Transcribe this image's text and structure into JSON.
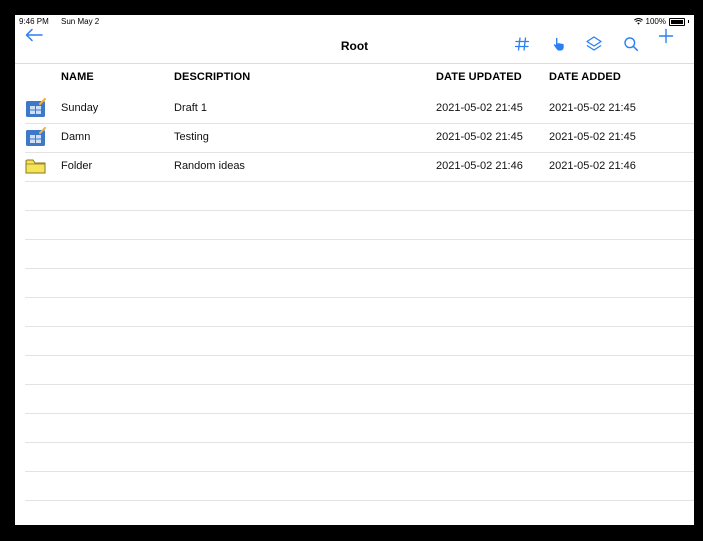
{
  "status": {
    "time": "9:46 PM",
    "date": "Sun May 2",
    "battery": "100%"
  },
  "nav": {
    "title": "Root"
  },
  "table": {
    "columns": [
      "NAME",
      "DESCRIPTION",
      "DATE UPDATED",
      "DATE ADDED"
    ],
    "rows": [
      {
        "icon": "database-icon",
        "name": "Sunday",
        "description": "Draft 1",
        "updated": "2021-05-02 21:45",
        "added": "2021-05-02 21:45"
      },
      {
        "icon": "database-icon",
        "name": "Damn",
        "description": "Testing",
        "updated": "2021-05-02 21:45",
        "added": "2021-05-02 21:45"
      },
      {
        "icon": "folder-icon",
        "name": "Folder",
        "description": "Random ideas",
        "updated": "2021-05-02 21:46",
        "added": "2021-05-02 21:46"
      }
    ]
  },
  "colors": {
    "accent": "#2a7ff6",
    "folder": "#f5e35a",
    "database": "#3e78c8"
  }
}
